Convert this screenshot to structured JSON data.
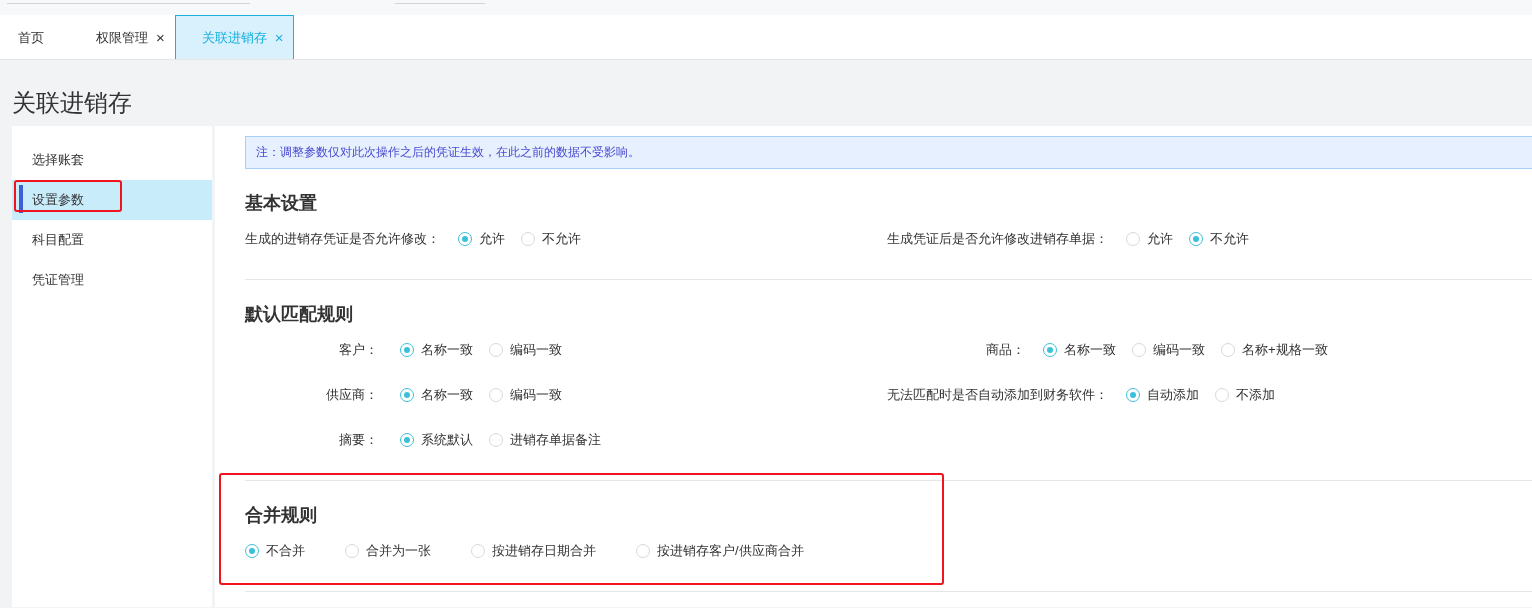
{
  "tabs": [
    {
      "label": "首页",
      "selected": false
    },
    {
      "label": "权限管理",
      "close": "×",
      "selected": false
    },
    {
      "label": "关联进销存",
      "close": "×",
      "selected": true
    }
  ],
  "page_title": "关联进销存",
  "sidebar": {
    "items": [
      {
        "label": "选择账套",
        "selected": false,
        "highlighted": false
      },
      {
        "label": "设置参数",
        "selected": true,
        "highlighted": true
      },
      {
        "label": "科目配置",
        "selected": false,
        "highlighted": false
      },
      {
        "label": "凭证管理",
        "selected": false,
        "highlighted": false
      }
    ]
  },
  "notice": "注：调整参数仅对此次操作之后的凭证生效，在此之前的数据不受影响。",
  "sections": [
    {
      "title": "基本设置",
      "kind": "plain",
      "highlighted": false,
      "rows": [
        {
          "fields": [
            {
              "label": "生成的进销存凭证是否允许修改：",
              "options": [
                {
                  "label": "允许",
                  "selected": true
                },
                {
                  "label": "不允许",
                  "selected": false
                }
              ]
            },
            {
              "label": "生成凭证后是否允许修改进销存单据：",
              "options": [
                {
                  "label": "允许",
                  "selected": false
                },
                {
                  "label": "不允许",
                  "selected": true
                }
              ]
            }
          ]
        }
      ]
    },
    {
      "title": "默认匹配规则",
      "kind": "aligned",
      "highlighted": false,
      "rows": [
        {
          "fields": [
            {
              "label": "客户：",
              "options": [
                {
                  "label": "名称一致",
                  "selected": true
                },
                {
                  "label": "编码一致",
                  "selected": false
                }
              ]
            },
            {
              "label": "商品：",
              "options": [
                {
                  "label": "名称一致",
                  "selected": true
                },
                {
                  "label": "编码一致",
                  "selected": false
                },
                {
                  "label": "名称+规格一致",
                  "selected": false
                }
              ]
            }
          ]
        },
        {
          "fields": [
            {
              "label": "供应商：",
              "options": [
                {
                  "label": "名称一致",
                  "selected": true
                },
                {
                  "label": "编码一致",
                  "selected": false
                }
              ]
            },
            {
              "label": "无法匹配时是否自动添加到财务软件：",
              "options": [
                {
                  "label": "自动添加",
                  "selected": true
                },
                {
                  "label": "不添加",
                  "selected": false
                }
              ]
            }
          ]
        },
        {
          "fields": [
            {
              "label": "摘要：",
              "options": [
                {
                  "label": "系统默认",
                  "selected": true
                },
                {
                  "label": "进销存单据备注",
                  "selected": false
                }
              ]
            }
          ]
        }
      ]
    },
    {
      "title": "合并规则",
      "kind": "inline",
      "highlighted": true,
      "rows": [
        {
          "fields": [
            {
              "options": [
                {
                  "label": "不合并",
                  "selected": true
                },
                {
                  "label": "合并为一张",
                  "selected": false
                },
                {
                  "label": "按进销存日期合并",
                  "selected": false
                },
                {
                  "label": "按进销存客户/供应商合并",
                  "selected": false
                }
              ]
            }
          ]
        }
      ]
    }
  ]
}
